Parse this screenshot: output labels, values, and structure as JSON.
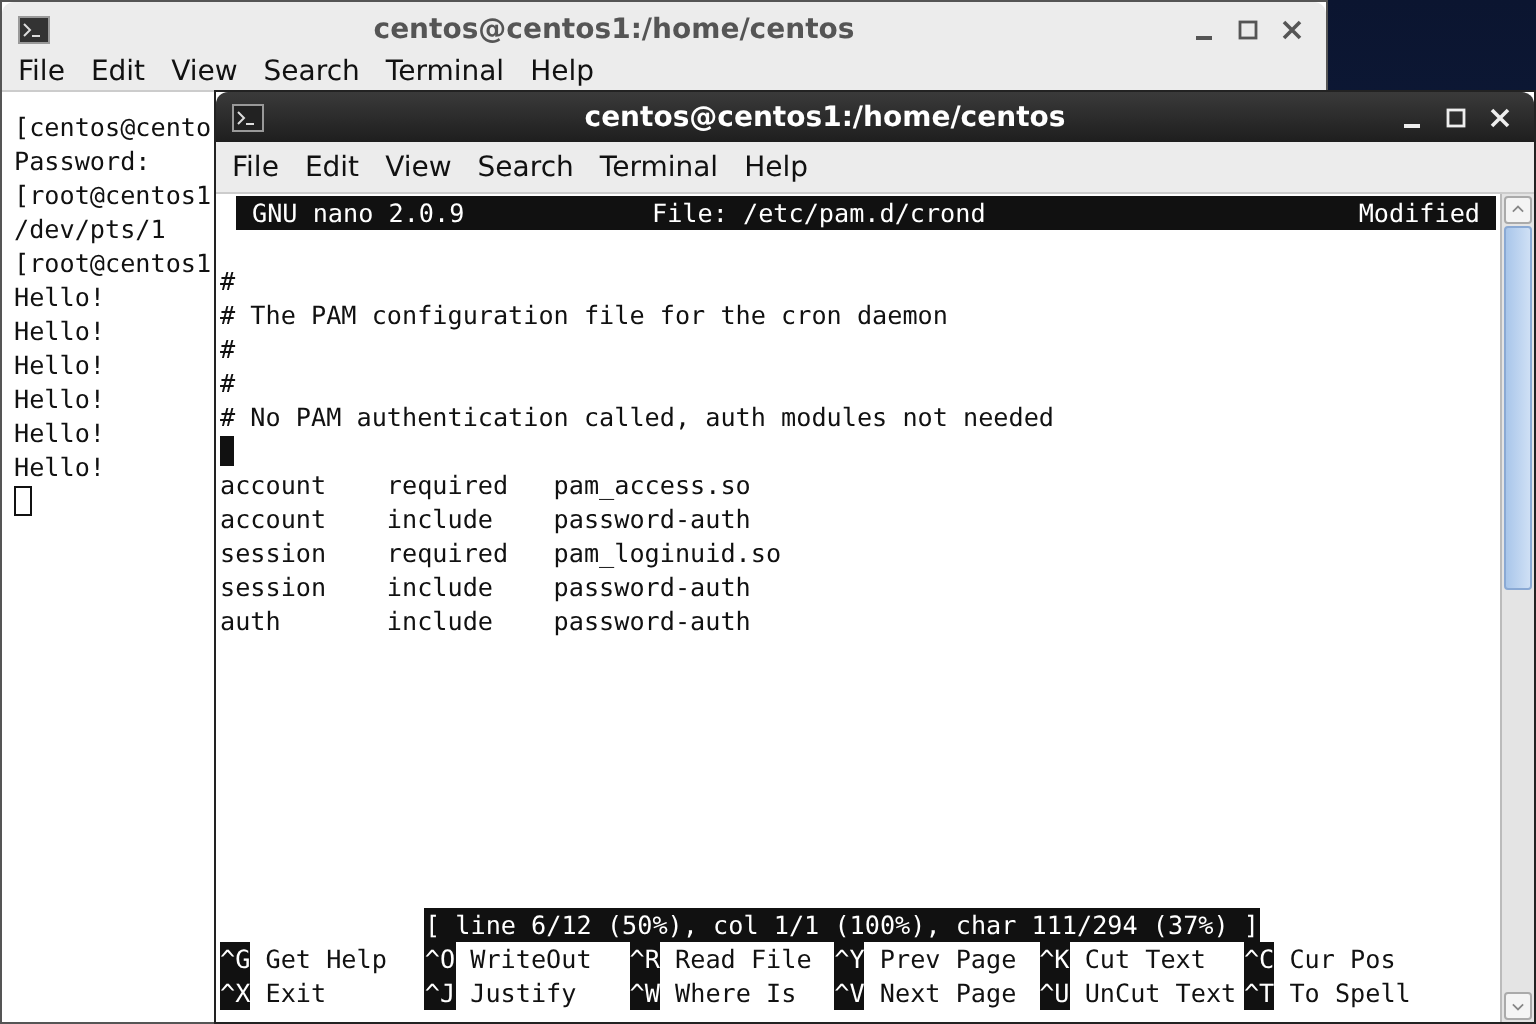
{
  "back_window": {
    "title": "centos@centos1:/home/centos",
    "menu": [
      "File",
      "Edit",
      "View",
      "Search",
      "Terminal",
      "Help"
    ],
    "lines": [
      {
        "kind": "text",
        "text": "[centos@cento"
      },
      {
        "kind": "text",
        "text": "Password:"
      },
      {
        "kind": "text",
        "text": "[root@centos1"
      },
      {
        "kind": "text",
        "text": "/dev/pts/1"
      },
      {
        "kind": "text",
        "text": "[root@centos1"
      },
      {
        "kind": "text",
        "text": "Hello!"
      },
      {
        "kind": "text",
        "text": "Hello!"
      },
      {
        "kind": "text",
        "text": "Hello!"
      },
      {
        "kind": "text",
        "text": "Hello!"
      },
      {
        "kind": "text",
        "text": "Hello!"
      },
      {
        "kind": "text",
        "text": "Hello!"
      },
      {
        "kind": "cursor"
      }
    ]
  },
  "front_window": {
    "title": "centos@centos1:/home/centos",
    "menu": [
      "File",
      "Edit",
      "View",
      "Search",
      "Terminal",
      "Help"
    ],
    "nano": {
      "version": "GNU nano 2.0.9",
      "file": "File: /etc/pam.d/crond",
      "state": "Modified",
      "lines": [
        {
          "kind": "text",
          "text": "#"
        },
        {
          "kind": "text",
          "text": "# The PAM configuration file for the cron daemon"
        },
        {
          "kind": "text",
          "text": "#"
        },
        {
          "kind": "text",
          "text": "#"
        },
        {
          "kind": "text",
          "text": "# No PAM authentication called, auth modules not needed"
        },
        {
          "kind": "cursor"
        },
        {
          "kind": "text",
          "text": "account    required   pam_access.so"
        },
        {
          "kind": "text",
          "text": "account    include    password-auth"
        },
        {
          "kind": "text",
          "text": "session    required   pam_loginuid.so"
        },
        {
          "kind": "text",
          "text": "session    include    password-auth"
        },
        {
          "kind": "text",
          "text": "auth       include    password-auth"
        }
      ],
      "status": "[ line 6/12 (50%), col 1/1 (100%), char 111/294 (37%) ]",
      "shortcuts": [
        [
          {
            "key": "^G",
            "label": "Get Help"
          },
          {
            "key": "^O",
            "label": "WriteOut"
          },
          {
            "key": "^R",
            "label": "Read File"
          },
          {
            "key": "^Y",
            "label": "Prev Page"
          },
          {
            "key": "^K",
            "label": "Cut Text"
          },
          {
            "key": "^C",
            "label": "Cur Pos"
          }
        ],
        [
          {
            "key": "^X",
            "label": "Exit"
          },
          {
            "key": "^J",
            "label": "Justify"
          },
          {
            "key": "^W",
            "label": "Where Is"
          },
          {
            "key": "^V",
            "label": "Next Page"
          },
          {
            "key": "^U",
            "label": "UnCut Text"
          },
          {
            "key": "^T",
            "label": "To Spell"
          }
        ]
      ]
    }
  }
}
